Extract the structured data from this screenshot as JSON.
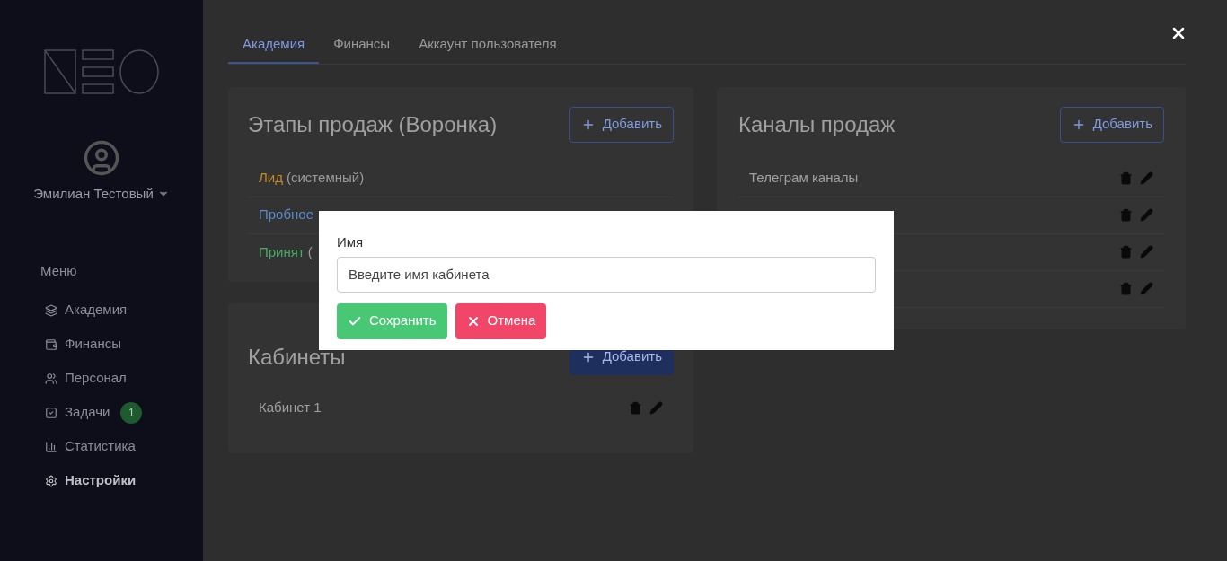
{
  "sidebar": {
    "user": {
      "name": "Эмилиан Тестовый"
    },
    "menu_title": "Меню",
    "items": [
      {
        "label": "Академия",
        "selected": false
      },
      {
        "label": "Финансы",
        "selected": false
      },
      {
        "label": "Персонал",
        "selected": false
      },
      {
        "label": "Задачи",
        "selected": false,
        "badge": "1"
      },
      {
        "label": "Статистика",
        "selected": false
      },
      {
        "label": "Настройки",
        "selected": true
      }
    ]
  },
  "tabs": [
    {
      "label": "Академия",
      "selected": true
    },
    {
      "label": "Финансы",
      "selected": false
    },
    {
      "label": "Аккаунт пользователя",
      "selected": false
    }
  ],
  "stages": {
    "title": "Этапы продаж (Воронка)",
    "add_button": "Добавить",
    "rows": [
      {
        "name": "Лид",
        "note": "(системный)",
        "color": "#c08a2a"
      },
      {
        "name": "Пробное",
        "color": "#5a8ac8"
      },
      {
        "name": "Принят",
        "note": "(",
        "color": "#4aa868"
      }
    ]
  },
  "rooms": {
    "title": "Кабинеты",
    "add_button": "Добавить",
    "rows": [
      {
        "name": "Кабинет 1"
      }
    ]
  },
  "channels": {
    "title": "Каналы продаж",
    "add_button": "Добавить",
    "rows": [
      {
        "name": "Телеграм каналы"
      },
      {},
      {},
      {}
    ]
  },
  "modal": {
    "label": "Имя",
    "placeholder": "Введите имя кабинета",
    "save": "Сохранить",
    "cancel": "Отмена"
  }
}
